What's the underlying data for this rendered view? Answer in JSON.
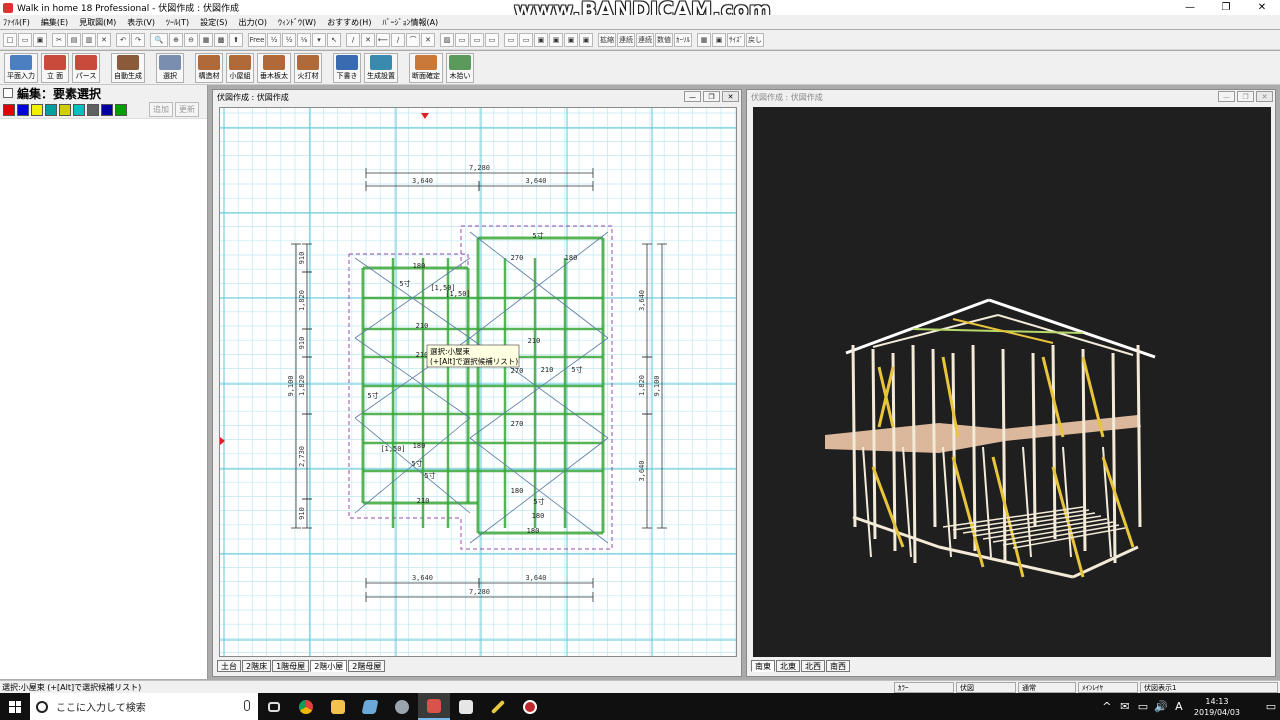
{
  "window": {
    "title": "Walk in home 18 Professional - 伏図作成 : 伏図作成",
    "watermark": "www.BANDICAM.com",
    "controls": [
      "—",
      "❐",
      "✕"
    ]
  },
  "menu": [
    "ﾌｧｲﾙ(F)",
    "編集(E)",
    "見取図(M)",
    "表示(V)",
    "ﾂｰﾙ(T)",
    "設定(S)",
    "出力(O)",
    "ｳｨﾝﾄﾞｳ(W)",
    "おすすめ(H)",
    "ﾊﾞｰｼﾞｮﾝ情報(A)"
  ],
  "toolbar1": [
    "□",
    "▭",
    "▣",
    "✂",
    "▤",
    "▥",
    "✕",
    "↶",
    "↷",
    "🔍",
    "⊕",
    "⊖",
    "▦",
    "▩",
    "⬆",
    "Free",
    "½",
    "½",
    "⅛",
    "▾",
    "↖",
    "/",
    "✕",
    "⟵",
    "/",
    "⌒",
    "✕",
    "▨",
    "▭",
    "▭",
    "▭",
    "▭",
    "▭",
    "▣",
    "▣",
    "▣",
    "▣",
    "拡縮",
    "連続",
    "連続",
    "数値",
    "ｶｰｿﾙ",
    "▦",
    "▣",
    "ｻｲｽﾞ",
    "戻し"
  ],
  "toolbar2": {
    "items": [
      {
        "label": "平面入力",
        "color": "#4a7fc1"
      },
      {
        "label": "立 面",
        "color": "#c94a3a"
      },
      {
        "label": "パース",
        "color": "#c94a3a"
      },
      {
        "label": "自動生成",
        "color": "#8a5a3a"
      },
      {
        "label": "選択",
        "color": "#7a8fb0"
      },
      {
        "label": "構造材",
        "color": "#b06a3a"
      },
      {
        "label": "小屋組",
        "color": "#b06a3a"
      },
      {
        "label": "垂木板太",
        "color": "#b06a3a"
      },
      {
        "label": "火打材",
        "color": "#b06a3a"
      },
      {
        "label": "下書き",
        "color": "#3a6ab0"
      },
      {
        "label": "生成設置",
        "color": "#3a8ab0"
      },
      {
        "label": "断面確定",
        "color": "#c97a3a"
      },
      {
        "label": "木拾い",
        "color": "#5a9a5a"
      }
    ]
  },
  "left_panel": {
    "title": "編集：要素選択",
    "palette": [
      "#e00000",
      "#0000e0",
      "#f0f000",
      "#00a0a0",
      "#d0d000",
      "#00c0c0",
      "#606060",
      "#0000a0",
      "#00a000"
    ],
    "buttons": [
      "追加",
      "更新"
    ]
  },
  "plan_window": {
    "title": "伏図作成 : 伏図作成",
    "tabs": [
      "土台",
      "2階床",
      "1階母屋",
      "2階小屋",
      "2階母屋"
    ],
    "active_tab": 3,
    "dimensions": {
      "top_total": "7,280",
      "top_left": "3,640",
      "top_right": "3,640",
      "bottom_left": "3,640",
      "bottom_right": "3,640",
      "bottom_total": "7,280",
      "left_1": "910",
      "left_2": "1,820",
      "left_3": "910",
      "left_4": "1,820",
      "left_5": "2,730",
      "left_6": "910",
      "left_total": "9,100",
      "right_1": "3,640",
      "right_2": "1,820",
      "right_3": "3,640",
      "right_total": "9,100"
    },
    "labels": [
      "180",
      "5寸",
      "270",
      "5寸",
      "210",
      "180",
      "[1,50]",
      "210",
      "210",
      "5寸",
      "270",
      "5寸",
      "210",
      "180",
      "5寸",
      "270",
      "5寸",
      "180",
      "5寸",
      "180",
      "210",
      "180",
      "[1,50]",
      "[1,50]"
    ],
    "tooltip": {
      "line1": "選択:小屋束",
      "line2": "(+[Alt]で選択候補リスト)"
    }
  },
  "view_window": {
    "title": "伏図作成 : 伏図作成",
    "tabs": [
      "南東",
      "北東",
      "北西",
      "南西"
    ],
    "active_tab": 0
  },
  "statusbar": {
    "message": "選択:小屋束 (+[Alt]で選択候補リスト)",
    "cells": [
      "ｶﾗｰ",
      "伏図",
      "通常",
      "ﾒｲﾝﾚｲﾔ",
      "伏図表示1"
    ]
  },
  "taskbar": {
    "search_placeholder": "ここに入力して検索",
    "time": "14:13",
    "date": "2019/04/03",
    "tray_icons": [
      "^",
      "✉",
      "▭",
      "🔊",
      "A",
      "▭"
    ]
  },
  "colors": {
    "grid_cyan": "#5fc8d8",
    "structure_green": "#3aa83a",
    "dim_dark": "#333333",
    "viewport_bg": "#1f1f1f"
  }
}
